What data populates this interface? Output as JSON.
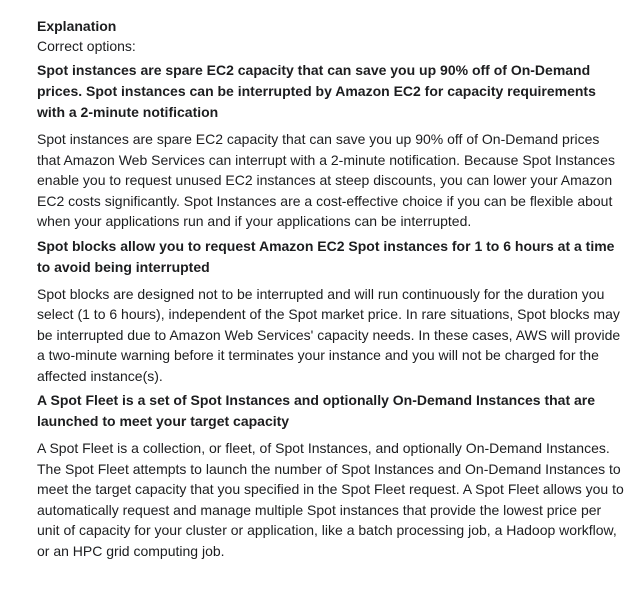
{
  "explanation": {
    "title": "Explanation",
    "subtitle": "Correct options:",
    "options": [
      {
        "heading": "Spot instances are spare EC2 capacity that can save you up 90% off of On-Demand prices. Spot instances can be interrupted by Amazon EC2 for capacity requirements with a 2-minute notification",
        "body": "Spot instances are spare EC2 capacity that can save you up 90% off of On-Demand prices that Amazon Web Services can interrupt with a 2-minute notification. Because Spot Instances enable you to request unused EC2 instances at steep discounts, you can lower your Amazon EC2 costs significantly. Spot Instances are a cost-effective choice if you can be flexible about when your applications run and if your applications can be interrupted."
      },
      {
        "heading": "Spot blocks allow you to request Amazon EC2 Spot instances for 1 to 6 hours at a time to avoid being interrupted",
        "body": "Spot blocks are designed not to be interrupted and will run continuously for the duration you select (1 to 6 hours), independent of the Spot market price. In rare situations, Spot blocks may be interrupted due to Amazon Web Services' capacity needs. In these cases, AWS will provide a two-minute warning before it terminates your instance and you will not be charged for the affected instance(s)."
      },
      {
        "heading": "A Spot Fleet is a set of Spot Instances and optionally On-Demand Instances that are launched to meet your target capacity",
        "body": "A Spot Fleet is a collection, or fleet, of Spot Instances, and optionally On-Demand Instances. The Spot Fleet attempts to launch the number of Spot Instances and On-Demand Instances to meet the target capacity that you specified in the Spot Fleet request. A Spot Fleet allows you to automatically request and manage multiple Spot instances that provide the lowest price per unit of capacity for your cluster or application, like a batch processing job, a Hadoop workflow, or an HPC grid computing job."
      }
    ]
  }
}
